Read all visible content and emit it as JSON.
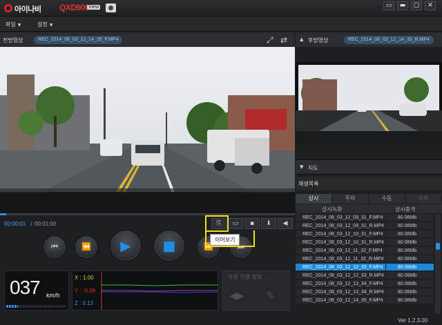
{
  "app": {
    "brand": "아이나비",
    "model": "QXD900",
    "view_badge": "View",
    "version": "Ver 1.2.3.00"
  },
  "window_controls": [
    "▭",
    "▬",
    "▢",
    "✕"
  ],
  "menu": [
    {
      "label": "파일"
    },
    {
      "label": "설정"
    }
  ],
  "front": {
    "label": "전방영상",
    "file": "REC_2014_08_03_12_14_35_F.MP4"
  },
  "rear": {
    "label": "후방영상",
    "file": "REC_2014_08_03_12_14_35_R.MP4"
  },
  "playback": {
    "current_time": "00:00:01",
    "separator": "/",
    "total_time": "00:01:00",
    "progress": 0.02,
    "tooltip": "이어보기"
  },
  "speed": {
    "value": "037",
    "unit": "km/h",
    "level": 0.2
  },
  "gsensor": {
    "x": "X : 1.00",
    "y": "Y : -0.09",
    "z": "Z : 0.13",
    "colors": {
      "x": "#f0c020",
      "y": "#e0302f",
      "z": "#2b8fe0"
    }
  },
  "link_panel": {
    "title": "차량 연결 정보"
  },
  "map": {
    "label": "지도"
  },
  "playlist": {
    "label": "재생목록",
    "tabs": [
      "상시",
      "주차",
      "수동",
      "외부"
    ],
    "columns": [
      "상시녹화",
      "상시충격"
    ],
    "rows": [
      {
        "file": "REC_2014_08_03_12_09_31_F.MP4",
        "size": "80.06Mb"
      },
      {
        "file": "REC_2014_08_03_12_09_31_R.MP4",
        "size": "80.06Mb"
      },
      {
        "file": "REC_2014_08_03_12_10_31_F.MP4",
        "size": "80.06Mb"
      },
      {
        "file": "REC_2014_08_03_12_10_31_R.MP4",
        "size": "80.06Mb"
      },
      {
        "file": "REC_2014_08_03_12_11_32_F.MP4",
        "size": "80.06Mb"
      },
      {
        "file": "REC_2014_08_03_12_11_32_R.MP4",
        "size": "80.06Mb"
      },
      {
        "file": "REC_2014_08_03_12_12_33_F.MP4",
        "size": "80.06Mb",
        "selected": true
      },
      {
        "file": "REC_2014_08_03_12_12_33_R.MP4",
        "size": "80.06Mb"
      },
      {
        "file": "REC_2014_08_03_12_13_34_F.MP4",
        "size": "80.06Mb"
      },
      {
        "file": "REC_2014_08_03_12_13_34_R.MP4",
        "size": "80.06Mb"
      },
      {
        "file": "REC_2014_08_03_12_14_35_F.MP4",
        "size": "80.06Mb"
      }
    ]
  }
}
